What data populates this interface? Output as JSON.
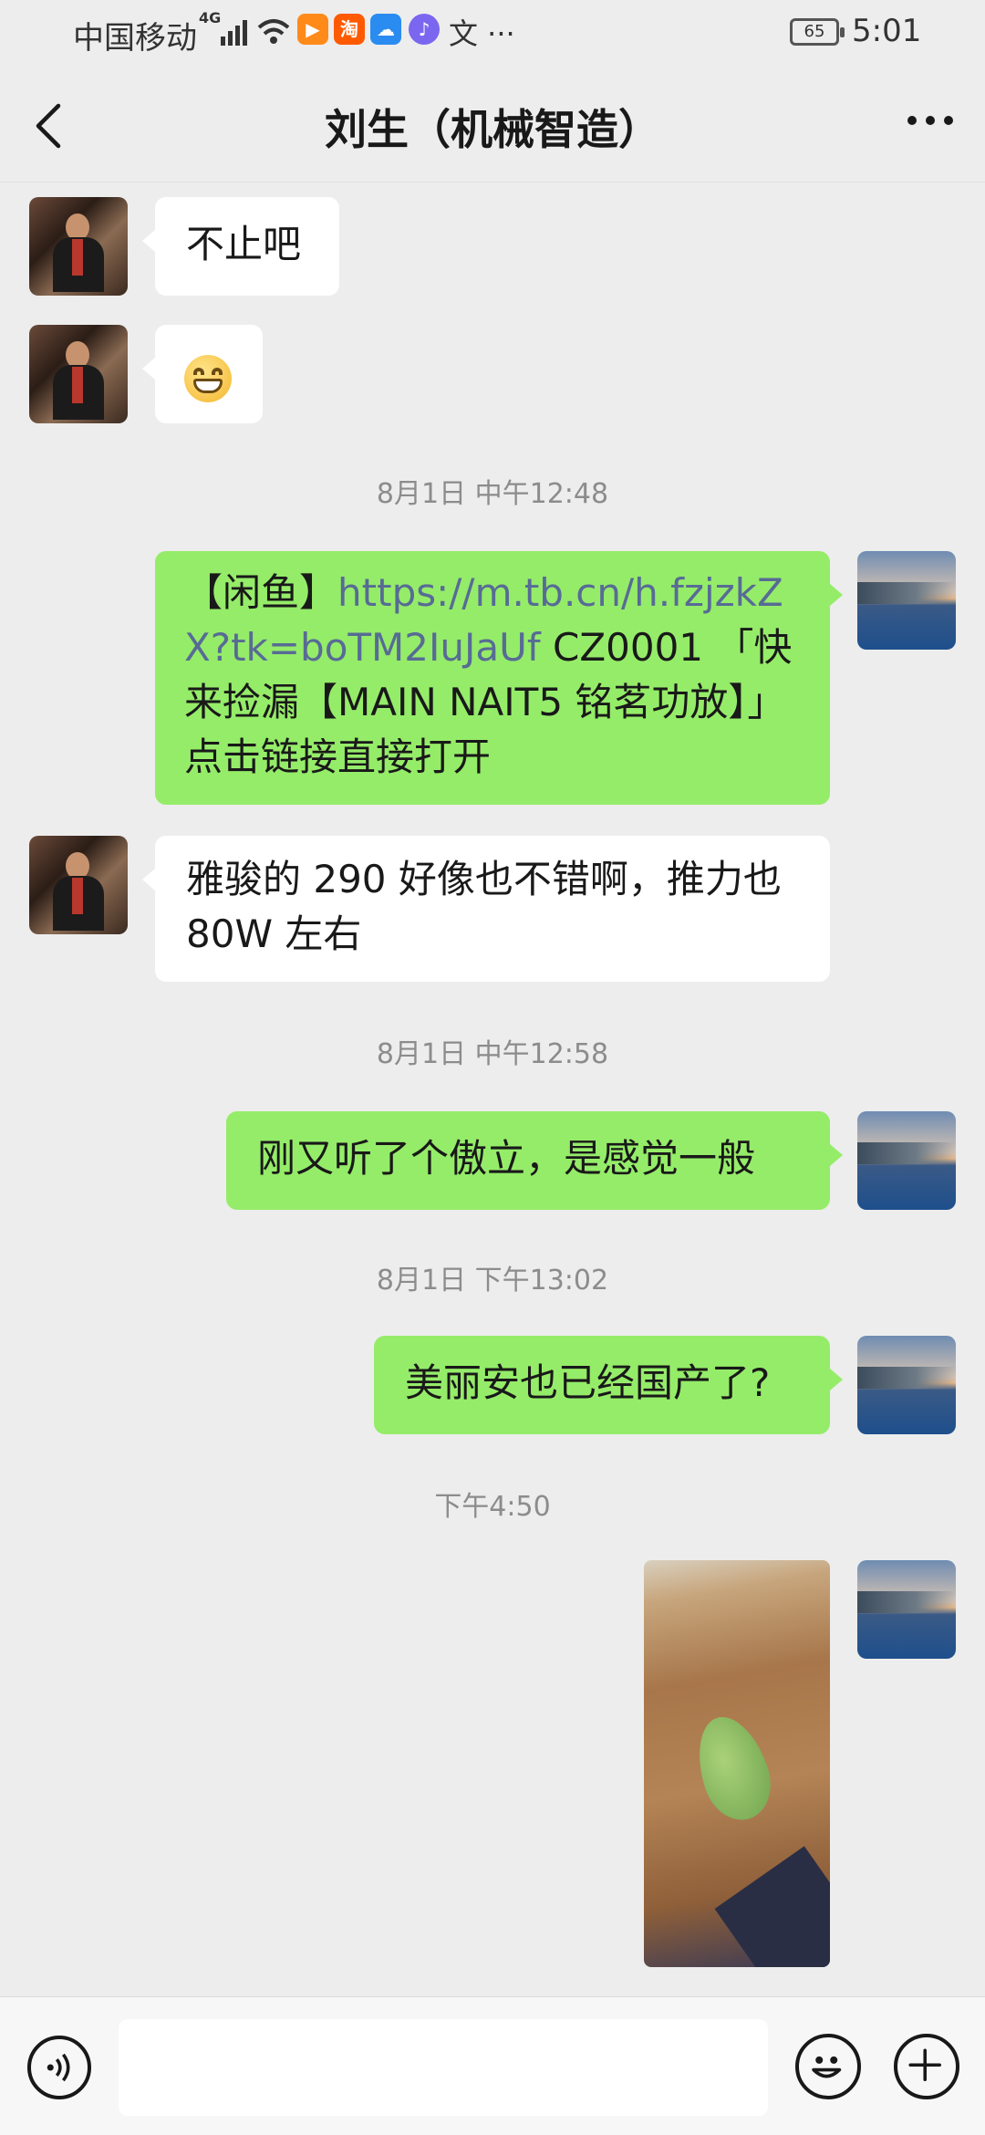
{
  "status_bar": {
    "carrier": "中国移动",
    "network": "4G",
    "extra": "文 ···",
    "battery": "65",
    "time": "5:01"
  },
  "header": {
    "title": "刘生（机械智造）"
  },
  "messages": [
    {
      "side": "left",
      "text": "不止吧"
    },
    {
      "side": "left",
      "emoji": "grinning-face-emoji"
    },
    {
      "timestamp": "8月1日 中午12:48"
    },
    {
      "side": "right",
      "prefix": "【闲鱼】",
      "link": "https://m.tb.cn/h.fzjzkZX?tk=boTM2IuJaUf",
      "text": " CZ0001 「快来捡漏【MAIN NAIT5 铭茗功放】」点击链接直接打开"
    },
    {
      "side": "left",
      "text": "雅骏的 290 好像也不错啊，推力也80W 左右"
    },
    {
      "timestamp": "8月1日 中午12:58"
    },
    {
      "side": "right",
      "text": "刚又听了个傲立，是感觉一般"
    },
    {
      "timestamp": "8月1日 下午13:02"
    },
    {
      "side": "right",
      "text": "美丽安也已经国产了?"
    },
    {
      "timestamp": "下午4:50"
    },
    {
      "side": "right",
      "image": "leaf-on-wooden-table-photo"
    }
  ],
  "colors": {
    "background": "#ededed",
    "bubble_right": "#95ec69",
    "bubble_left": "#ffffff",
    "link": "#576b95",
    "timestamp": "#8c8c8c"
  },
  "icons": {
    "back": "chevron-left-icon",
    "menu": "more-dots-icon",
    "voice": "voice-icon",
    "emoji": "emoji-face-icon",
    "plus": "plus-icon"
  },
  "input": {
    "value": ""
  }
}
